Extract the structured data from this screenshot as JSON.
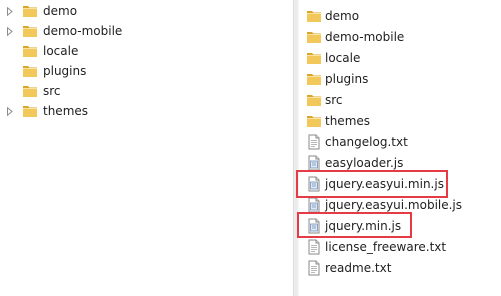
{
  "tree": {
    "items": [
      {
        "label": "demo",
        "expandable": true,
        "icon": "folder-icon"
      },
      {
        "label": "demo-mobile",
        "expandable": true,
        "icon": "folder-icon"
      },
      {
        "label": "locale",
        "expandable": false,
        "icon": "folder-icon"
      },
      {
        "label": "plugins",
        "expandable": false,
        "icon": "folder-icon"
      },
      {
        "label": "src",
        "expandable": false,
        "icon": "folder-icon"
      },
      {
        "label": "themes",
        "expandable": true,
        "icon": "folder-icon"
      }
    ]
  },
  "files": {
    "items": [
      {
        "label": "demo",
        "type": "folder"
      },
      {
        "label": "demo-mobile",
        "type": "folder"
      },
      {
        "label": "locale",
        "type": "folder"
      },
      {
        "label": "plugins",
        "type": "folder"
      },
      {
        "label": "src",
        "type": "folder"
      },
      {
        "label": "themes",
        "type": "folder"
      },
      {
        "label": "changelog.txt",
        "type": "text"
      },
      {
        "label": "easyloader.js",
        "type": "script"
      },
      {
        "label": "jquery.easyui.min.js",
        "type": "script",
        "highlighted": true
      },
      {
        "label": "jquery.easyui.mobile.js",
        "type": "script"
      },
      {
        "label": "jquery.min.js",
        "type": "script",
        "highlighted": true
      },
      {
        "label": "license_freeware.txt",
        "type": "text"
      },
      {
        "label": "readme.txt",
        "type": "text"
      }
    ]
  },
  "colors": {
    "folder_fill": "#f3c85a",
    "folder_dark": "#d9a52a",
    "highlight": "#e63a46"
  }
}
